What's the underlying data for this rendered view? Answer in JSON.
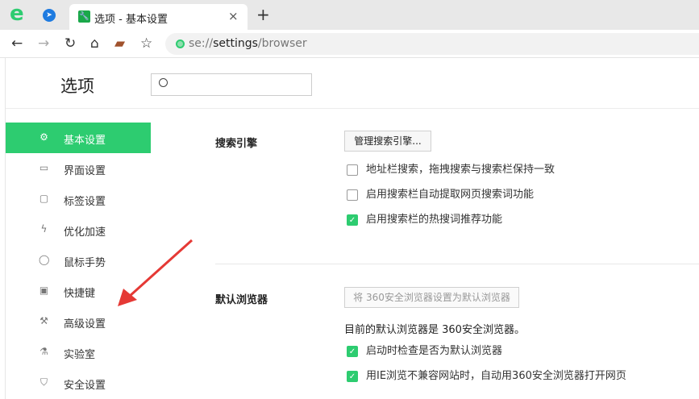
{
  "browser": {
    "tab_title": "选项 - 基本设置",
    "url_scheme": "se://",
    "url_host": "settings",
    "url_path": "/browser",
    "new_tab": "+",
    "close": "×"
  },
  "page": {
    "title": "选项",
    "search_placeholder": ""
  },
  "sidebar": {
    "items": [
      {
        "label": "基本设置",
        "icon": "gear-icon",
        "active": true
      },
      {
        "label": "界面设置",
        "icon": "window-icon"
      },
      {
        "label": "标签设置",
        "icon": "tab-icon"
      },
      {
        "label": "优化加速",
        "icon": "lightning-icon"
      },
      {
        "label": "鼠标手势",
        "icon": "mouse-icon"
      },
      {
        "label": "快捷键",
        "icon": "keyboard-icon"
      },
      {
        "label": "高级设置",
        "icon": "wrench-icon"
      },
      {
        "label": "实验室",
        "icon": "flask-icon"
      },
      {
        "label": "安全设置",
        "icon": "shield-icon"
      }
    ]
  },
  "search_engine": {
    "heading": "搜索引擎",
    "manage_button": "管理搜索引擎...",
    "options": [
      {
        "label": "地址栏搜索，拖拽搜索与搜索栏保持一致",
        "checked": false
      },
      {
        "label": "启用搜索栏自动提取网页搜索词功能",
        "checked": false
      },
      {
        "label": "启用搜索栏的热搜词推荐功能",
        "checked": true
      }
    ]
  },
  "default_browser": {
    "heading": "默认浏览器",
    "set_button": "将 360安全浏览器设置为默认浏览器",
    "status": "目前的默认浏览器是 360安全浏览器。",
    "options": [
      {
        "label": "启动时检查是否为默认浏览器",
        "checked": true
      },
      {
        "label": "用IE浏览不兼容网站时，自动用360安全浏览器打开网页",
        "checked": true
      }
    ]
  },
  "colors": {
    "accent": "#2dcc70",
    "annotation": "#e53935"
  }
}
